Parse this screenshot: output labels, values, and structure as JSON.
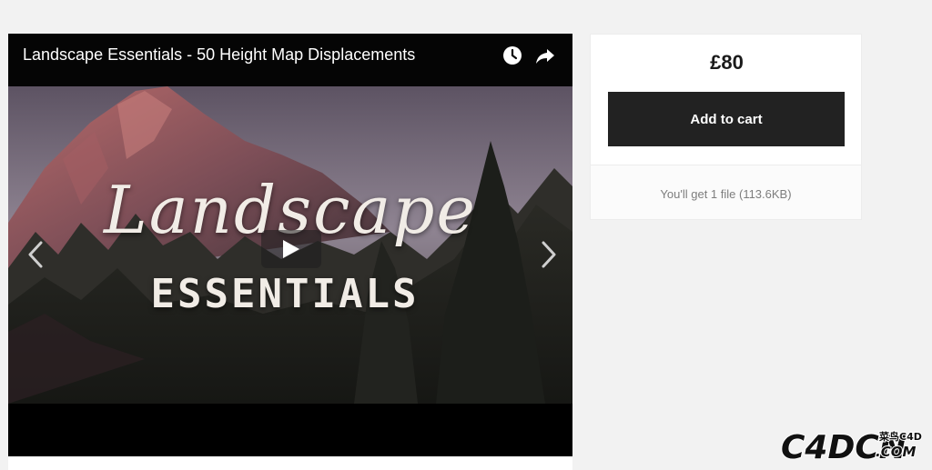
{
  "player": {
    "title": "Landscape Essentials - 50 Height Map Displacements",
    "watch_later_icon": "clock-icon",
    "share_icon": "share-arrow-icon",
    "play_icon": "play-icon",
    "prev_icon": "chevron-left-icon",
    "next_icon": "chevron-right-icon",
    "overlay": {
      "title": "Landscape",
      "subtitle": "ESSENTIALS"
    }
  },
  "purchase": {
    "price": "£80",
    "add_to_cart_label": "Add to cart",
    "file_info": "You'll get 1 file (113.6KB)"
  },
  "watermark": {
    "main": "C4DCN",
    "cn": "菜鸟C4D",
    "dotcom": ".COM"
  },
  "colors": {
    "page_bg": "#f2f2f2",
    "button_bg": "#222222",
    "player_bg": "#000000"
  }
}
